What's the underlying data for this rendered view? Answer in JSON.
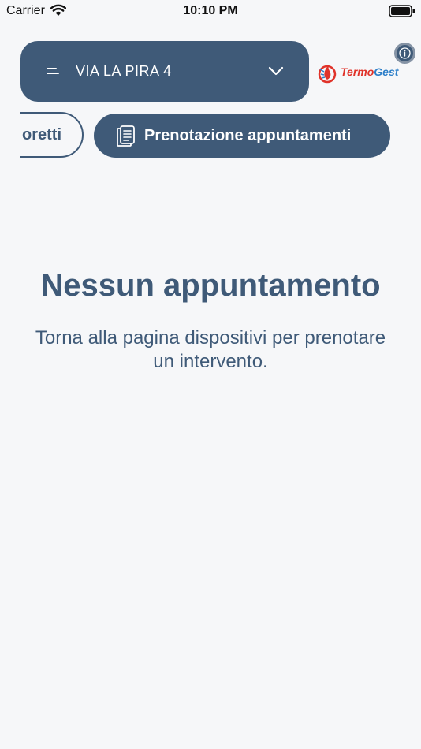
{
  "status_bar": {
    "carrier": "Carrier",
    "time": "10:10 PM"
  },
  "header": {
    "address": "VIA LA PIRA 4",
    "logo": {
      "part1": "Termo",
      "part2": "Gest"
    }
  },
  "tabs": [
    {
      "label": "oretti"
    },
    {
      "label": "Prenotazione appuntamenti"
    }
  ],
  "empty_state": {
    "title": "Nessun appuntamento",
    "message": "Torna alla pagina dispositivi per prenotare un intervento."
  },
  "colors": {
    "primary": "#3f5a78",
    "background": "#f6f7f9",
    "logo_red": "#e0332a",
    "logo_blue": "#2d7fc9"
  },
  "icons": [
    "wifi-icon",
    "battery-icon",
    "menu-icon",
    "chevron-down-icon",
    "info-icon",
    "document-icon"
  ]
}
